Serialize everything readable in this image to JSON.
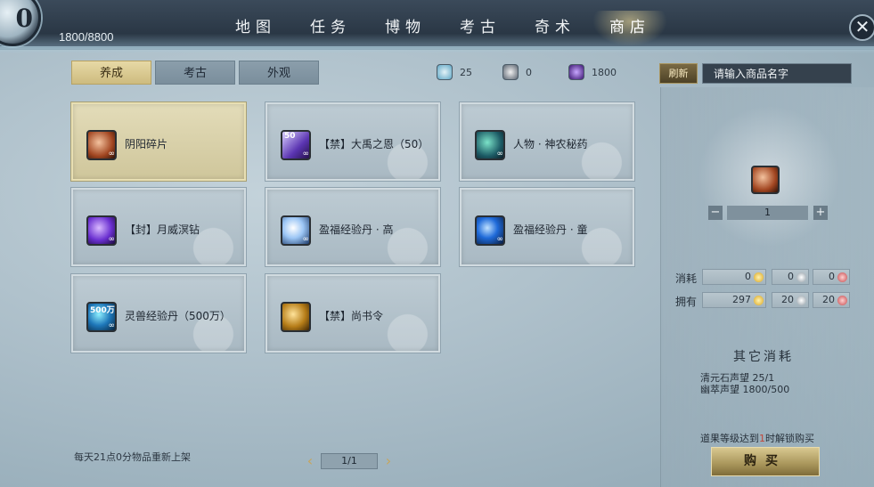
{
  "header": {
    "level_badge": "0",
    "exp_text": "1800/8800",
    "nav": [
      {
        "label": "地图"
      },
      {
        "label": "任务"
      },
      {
        "label": "博物"
      },
      {
        "label": "考古"
      },
      {
        "label": "奇术"
      },
      {
        "label": "商店",
        "active": true
      }
    ],
    "close_glyph": "✕"
  },
  "tabs": [
    {
      "label": "养成",
      "active": true
    },
    {
      "label": "考古"
    },
    {
      "label": "外观"
    }
  ],
  "currencies": [
    {
      "icon": "stone-icon",
      "value": "25"
    },
    {
      "icon": "cat-icon",
      "value": "0"
    },
    {
      "icon": "orb-icon",
      "value": "1800"
    }
  ],
  "search": {
    "refresh_label": "刷新",
    "placeholder": "请输入商品名字"
  },
  "items": [
    {
      "name": "阴阳碎片",
      "icon": "shard-icon",
      "selected": true
    },
    {
      "name": "【禁】大禹之恩（50）",
      "icon": "book-icon",
      "badge": "50"
    },
    {
      "name": "人物 · 神农秘药",
      "icon": "herb-icon"
    },
    {
      "name": "【封】月威溟钻",
      "icon": "gem-icon"
    },
    {
      "name": "盈福经验丹 · 高",
      "icon": "pill-white-icon"
    },
    {
      "name": "盈福经验丹 · 童",
      "icon": "pill-blue-icon"
    },
    {
      "name": "灵兽经验丹（500万）",
      "icon": "beast-pill-icon",
      "badge": "500万"
    },
    {
      "name": "【禁】尚书令",
      "icon": "token-icon"
    }
  ],
  "item_infinity": "∞",
  "footer": {
    "note": "每天21点0分物品重新上架",
    "page": "1/1",
    "prev": "‹",
    "next": "›"
  },
  "detail": {
    "quantity": "1",
    "minus": "−",
    "plus": "+",
    "cost_label": "消耗",
    "owned_label": "拥有",
    "cost": [
      "0",
      "0",
      "0"
    ],
    "owned": [
      "297",
      "20",
      "20"
    ],
    "other_title": "其它消耗",
    "other_lines": [
      "清元石声望  25/1",
      "幽萃声望  1800/500"
    ],
    "unlock_prefix": "道果等级达到",
    "unlock_level": "1",
    "unlock_suffix": "时解锁购买",
    "buy_label": "购买"
  }
}
